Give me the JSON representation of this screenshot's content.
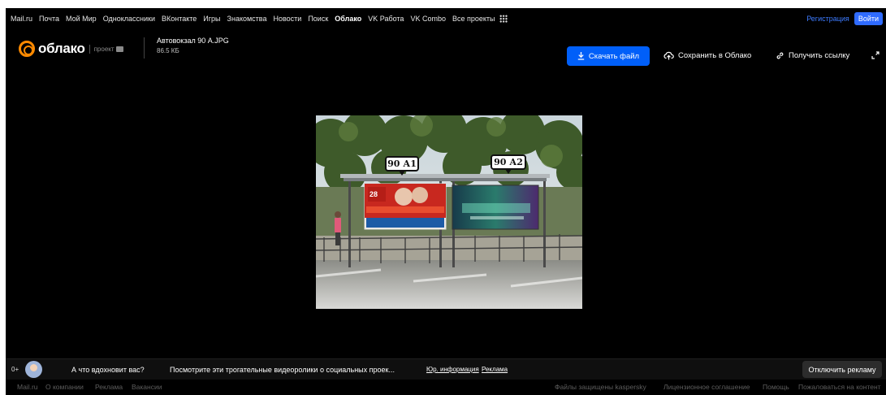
{
  "portal": {
    "links": [
      "Mail.ru",
      "Почта",
      "Мой Мир",
      "Одноклассники",
      "ВКонтакте",
      "Игры",
      "Знакомства",
      "Новости",
      "Поиск",
      "Облако",
      "VK Работа",
      "VK Combo",
      "Все проекты"
    ],
    "active": "Облако",
    "register": "Регистрация",
    "login": "Войти"
  },
  "header": {
    "logo": "облако",
    "project": "проект",
    "file_name": "Автовокзал 90 А.JPG",
    "file_size": "86.5 КБ",
    "download": "Скачать файл",
    "save": "Сохранить в Облако",
    "get_link": "Получить ссылку"
  },
  "photo": {
    "label_a1": "90 А1",
    "label_a2": "90 А2"
  },
  "ad": {
    "age": "0+",
    "title": "А что вдохновит вас?",
    "text": "Посмотрите эти трогательные видеоролики о социальных проек...",
    "legal": "Юр. информация",
    "ads": "Реклама",
    "disable": "Отключить рекламу"
  },
  "footer": {
    "mailru": "Mail.ru",
    "company": "О компании",
    "adverts": "Реклама",
    "jobs": "Вакансии",
    "protected": "Файлы защищены",
    "kaspersky": "kaspersky",
    "license": "Лицензионное соглашение",
    "help": "Помощь",
    "report": "Пожаловаться на контент"
  },
  "colors": {
    "accent": "#005ff9",
    "logo": "#ff8a00",
    "kaspersky": "#00a88e"
  }
}
